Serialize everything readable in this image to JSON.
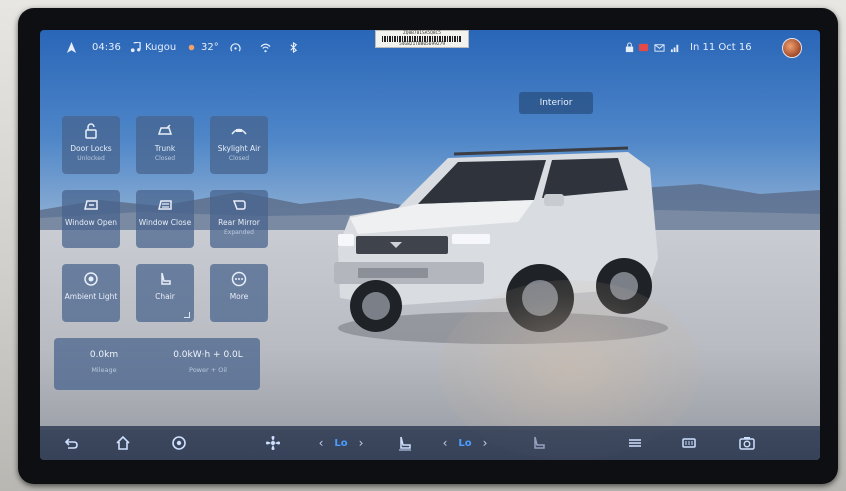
{
  "status_bar": {
    "time": "04:36",
    "media_app": "Kugou",
    "temperature": "32°",
    "date": "In  11  Oct  16",
    "barcode_text": "54G821TB805699279",
    "barcode_header": "ZQ0B701SA5Q8C5"
  },
  "overlay": {
    "interior_button": "Interior"
  },
  "controls": [
    {
      "label": "Door Locks",
      "sub": "Unlocked",
      "icon": "lock-icon"
    },
    {
      "label": "Trunk",
      "sub": "Closed",
      "icon": "trunk-icon"
    },
    {
      "label": "Skylight Air",
      "sub": "Closed",
      "icon": "skylight-icon"
    },
    {
      "label": "Window Open",
      "sub": "",
      "icon": "window-open-icon"
    },
    {
      "label": "Window Close",
      "sub": "",
      "icon": "window-close-icon"
    },
    {
      "label": "Rear Mirror",
      "sub": "Expanded",
      "icon": "mirror-icon"
    },
    {
      "label": "Ambient Light",
      "sub": "",
      "icon": "ambient-light-icon"
    },
    {
      "label": "Chair",
      "sub": "",
      "icon": "seat-icon"
    },
    {
      "label": "More",
      "sub": "",
      "icon": "more-icon"
    }
  ],
  "stats": {
    "mileage_value": "0.0km",
    "mileage_label": "Mileage",
    "power_value": "0.0kW·h + 0.0L",
    "power_label": "Power + Oil"
  },
  "dock": {
    "left_temp": "Lo",
    "right_temp": "Lo",
    "icons": [
      "back-icon",
      "home-icon",
      "settings-icon",
      "fan-icon",
      "seat-heat-icon",
      "defrost-icon",
      "rear-defrost-icon",
      "camera-icon"
    ]
  },
  "colors": {
    "accent": "#4a9cff",
    "tile_bg": "#46628c"
  }
}
